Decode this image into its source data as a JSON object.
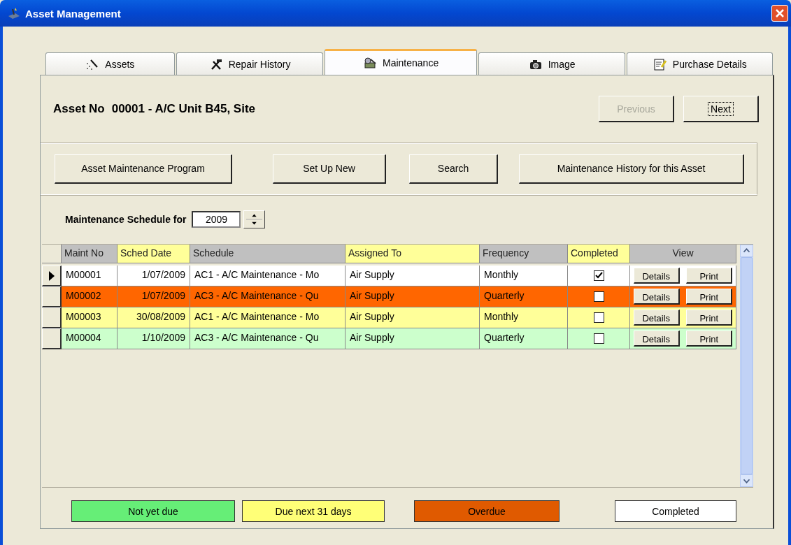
{
  "window": {
    "title": "Asset Management"
  },
  "tabs": [
    {
      "label": "Assets",
      "selected": false
    },
    {
      "label": "Repair History",
      "selected": false
    },
    {
      "label": "Maintenance",
      "selected": true
    },
    {
      "label": "Image",
      "selected": false
    },
    {
      "label": "Purchase Details",
      "selected": false
    }
  ],
  "asset": {
    "label": "Asset No",
    "value": "00001 - A/C Unit B45, Site"
  },
  "nav_buttons": [
    {
      "label": "Previous",
      "disabled": true,
      "focused": false
    },
    {
      "label": "Next",
      "disabled": false,
      "focused": true
    }
  ],
  "action_buttons": [
    "Asset Maintenance Program",
    "Set Up New",
    "Search",
    "Maintenance History for this Asset"
  ],
  "schedule": {
    "label": "Maintenance Schedule for",
    "year": "2009"
  },
  "grid": {
    "columns": [
      {
        "label": "Maint No",
        "color": "#c0c0c0"
      },
      {
        "label": "Sched Date",
        "color": "#ffff99"
      },
      {
        "label": "Schedule",
        "color": "#c0c0c0"
      },
      {
        "label": "Assigned To",
        "color": "#ffff99"
      },
      {
        "label": "Frequency",
        "color": "#c0c0c0"
      },
      {
        "label": "Completed",
        "color": "#ffff99"
      },
      {
        "label": "View",
        "color": "#c0c0c0"
      }
    ],
    "rows": [
      {
        "selected": true,
        "color": "#ffffff",
        "cells": [
          "M00001",
          "1/07/2009",
          "AC1 - A/C Maintenance - Mo",
          "Air Supply",
          "Monthly"
        ],
        "completed": true,
        "actions": [
          "Details",
          "Print"
        ]
      },
      {
        "selected": false,
        "color": "#ff6600",
        "cells": [
          "M00002",
          "1/07/2009",
          "AC3 - A/C Maintenance - Qu",
          "Air Supply",
          "Quarterly"
        ],
        "completed": false,
        "actions": [
          "Details",
          "Print"
        ]
      },
      {
        "selected": false,
        "color": "#ffff99",
        "cells": [
          "M00003",
          "30/08/2009",
          "AC1 - A/C Maintenance - Mo",
          "Air Supply",
          "Monthly"
        ],
        "completed": false,
        "actions": [
          "Details",
          "Print"
        ]
      },
      {
        "selected": false,
        "color": "#ccffcc",
        "cells": [
          "M00004",
          "1/10/2009",
          "AC3 - A/C Maintenance - Qu",
          "Air Supply",
          "Quarterly"
        ],
        "completed": false,
        "actions": [
          "Details",
          "Print"
        ]
      }
    ]
  },
  "legend": [
    {
      "label": "Not yet due",
      "color": "#66ee77"
    },
    {
      "label": "Due next 31 days",
      "color": "#ffff77"
    },
    {
      "label": "Overdue",
      "color": "#e05a00"
    },
    {
      "label": "Completed",
      "color": "#ffffff"
    }
  ]
}
